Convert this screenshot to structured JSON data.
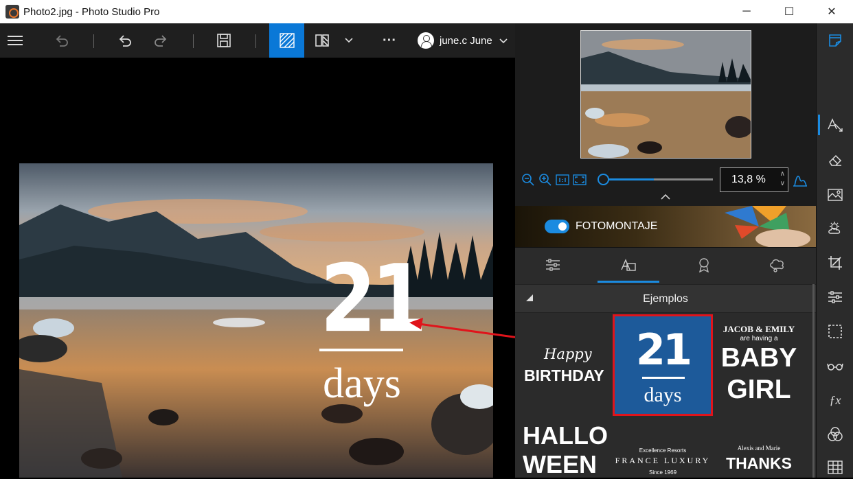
{
  "window": {
    "title": "Photo2.jpg - Photo Studio Pro",
    "controls": {
      "minimize": "─",
      "maximize": "☐",
      "close": "✕"
    }
  },
  "toolbar": {
    "user_name": "june.c June",
    "more": "···"
  },
  "canvas": {
    "overlay_number": "21",
    "overlay_text": "days"
  },
  "navigator": {
    "zoom_value": "13,8 %"
  },
  "banner": {
    "label": "FOTOMONTAJE",
    "toggle_on": true
  },
  "tabs": [
    "adjust-tab",
    "text-tab",
    "badge-tab",
    "clipart-tab"
  ],
  "examples": {
    "section_title": "Ejemplos",
    "birthday": {
      "line1": "Happy",
      "line2": "BIRTHDAY"
    },
    "selected": {
      "number": "21",
      "text": "days"
    },
    "baby": {
      "line1": "JACOB & EMILY",
      "line2": "are having a",
      "line3": "BABY",
      "line4": "GIRL"
    },
    "halloween": {
      "line1": "HALLO",
      "line2": "WEEN"
    },
    "france": {
      "line1": "Excellence Resorts",
      "line2": "FRANCE LUXURY",
      "line3": "Since 1969"
    },
    "thanks": {
      "line1": "Alexis and Marie",
      "line2": "THANKS"
    }
  },
  "colors": {
    "accent": "#0a78d7",
    "selection_border": "#e0141b",
    "selected_tile": "#1d5a9a",
    "panel_bg": "#2b2b2b"
  }
}
